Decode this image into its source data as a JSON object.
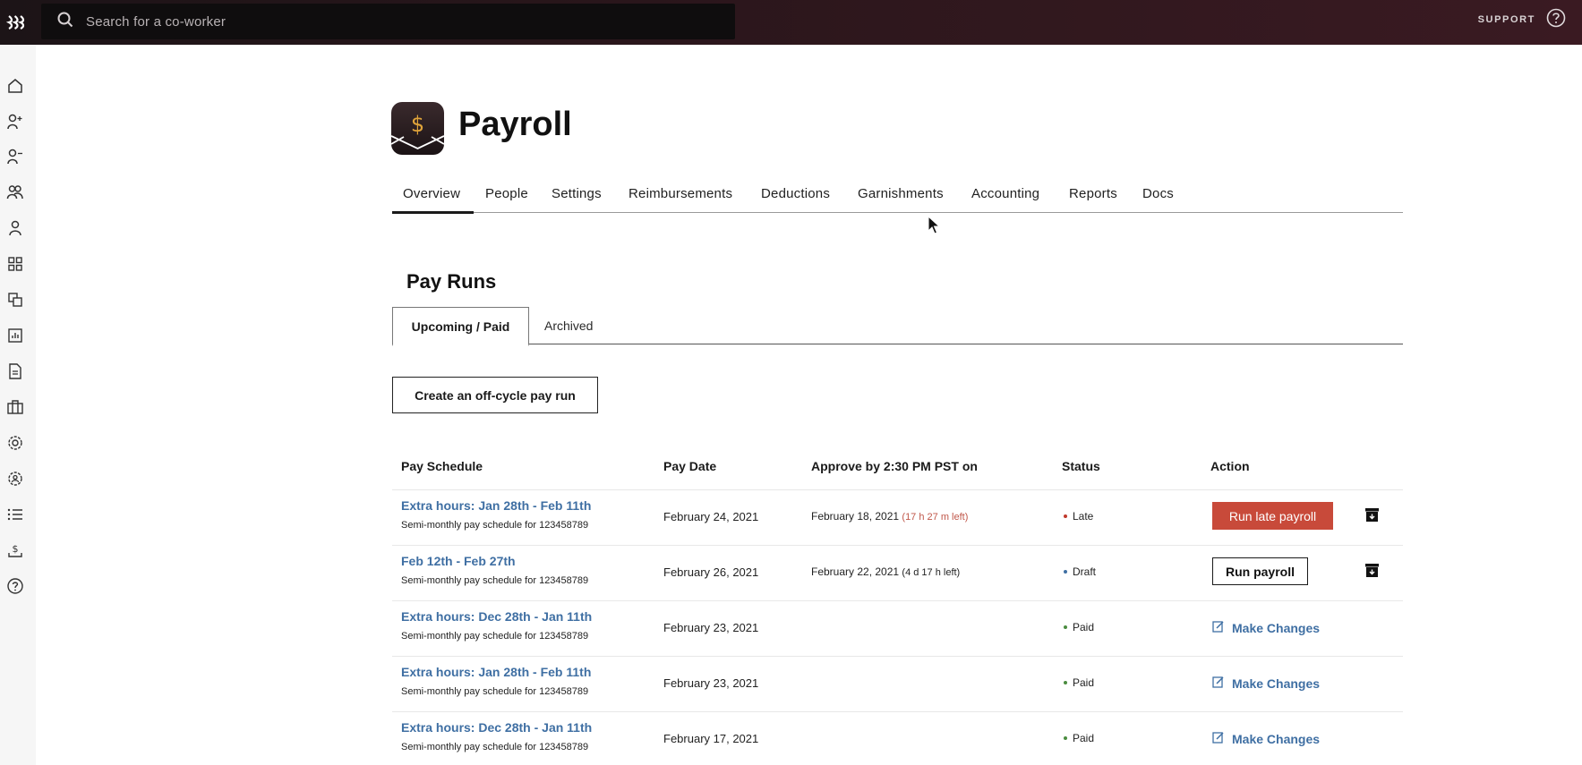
{
  "topbar": {
    "search_placeholder": "Search for a co-worker",
    "support_label": "SUPPORT"
  },
  "sidebar": {
    "items": [
      {
        "icon": "home-icon"
      },
      {
        "icon": "add-person-icon"
      },
      {
        "icon": "remove-person-icon"
      },
      {
        "icon": "people-icon"
      },
      {
        "icon": "person-icon"
      },
      {
        "icon": "apps-grid-icon"
      },
      {
        "icon": "layers-icon"
      },
      {
        "icon": "chart-icon"
      },
      {
        "icon": "document-icon"
      },
      {
        "icon": "briefcase-icon"
      },
      {
        "icon": "settings-icon"
      },
      {
        "icon": "admin-settings-icon"
      },
      {
        "icon": "list-icon"
      },
      {
        "icon": "payroll-icon"
      },
      {
        "icon": "help-icon"
      }
    ]
  },
  "page": {
    "title": "Payroll",
    "app_icon_symbol": "$"
  },
  "nav": {
    "tabs": [
      "Overview",
      "People",
      "Settings",
      "Reimbursements",
      "Deductions",
      "Garnishments",
      "Accounting",
      "Reports",
      "Docs"
    ],
    "active": "Overview"
  },
  "pay_runs": {
    "title": "Pay Runs",
    "subtabs": [
      "Upcoming / Paid",
      "Archived"
    ],
    "create_button": "Create an off-cycle pay run",
    "columns": [
      "Pay Schedule",
      "Pay Date",
      "Approve by 2:30 PM PST on",
      "Status",
      "Action"
    ],
    "rows": [
      {
        "schedule": "Extra hours: Jan 28th - Feb 11th",
        "subtitle": "Semi-monthly pay schedule for 123458789",
        "pay_date": "February 24, 2021",
        "approve_by": "February 18, 2021",
        "remaining": "(17 h 27 m left)",
        "status": "Late",
        "status_color": "#c0392b",
        "action": "Run late payroll"
      },
      {
        "schedule": "Feb 12th - Feb 27th",
        "subtitle": "Semi-monthly pay schedule for 123458789",
        "pay_date": "February 26, 2021",
        "approve_by": "February 22, 2021",
        "remaining": "(4 d 17 h left)",
        "status": "Draft",
        "status_color": "#3f6fa3",
        "action": "Run payroll"
      },
      {
        "schedule": "Extra hours: Dec 28th - Jan 11th",
        "subtitle": "Semi-monthly pay schedule for 123458789",
        "pay_date": "February 23, 2021",
        "approve_by": "",
        "remaining": "",
        "status": "Paid",
        "status_color": "#4a8c3f",
        "action": "Make Changes"
      },
      {
        "schedule": "Extra hours: Jan 28th - Feb 11th",
        "subtitle": "Semi-monthly pay schedule for 123458789",
        "pay_date": "February 23, 2021",
        "approve_by": "",
        "remaining": "",
        "status": "Paid",
        "status_color": "#4a8c3f",
        "action": "Make Changes"
      },
      {
        "schedule": "Extra hours: Dec 28th - Jan 11th",
        "subtitle": "Semi-monthly pay schedule for 123458789",
        "pay_date": "February 17, 2021",
        "approve_by": "",
        "remaining": "",
        "status": "Paid",
        "status_color": "#4a8c3f",
        "action": "Make Changes"
      }
    ]
  },
  "colors": {
    "topbar": "#2a161b",
    "link": "#3f6fa3",
    "late_button": "#c84a3a"
  }
}
